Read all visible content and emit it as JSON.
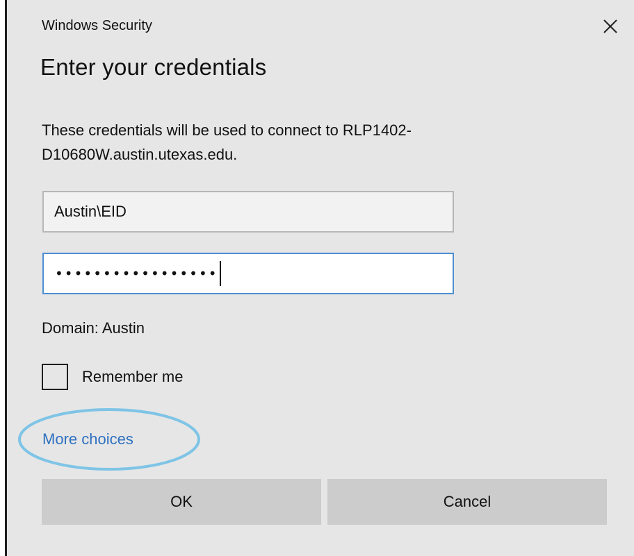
{
  "dialog": {
    "window_title": "Windows Security",
    "heading": "Enter your credentials",
    "description": "These credentials will be used to connect to RLP1402-D10680W.austin.utexas.edu.",
    "username_value": "Austin\\EID",
    "password_masked": "•••••••••••••••••",
    "domain_label": "Domain: Austin",
    "remember_me_label": "Remember me",
    "remember_me_checked": false,
    "more_choices_label": "More choices",
    "ok_label": "OK",
    "cancel_label": "Cancel",
    "close_icon": "close-icon"
  },
  "colors": {
    "dialog_background": "#e6e6e6",
    "link": "#2f71c1",
    "focused_border": "#4f8fd0",
    "button_background": "#cccccc",
    "highlight_ellipse": "#7ec4e6"
  }
}
